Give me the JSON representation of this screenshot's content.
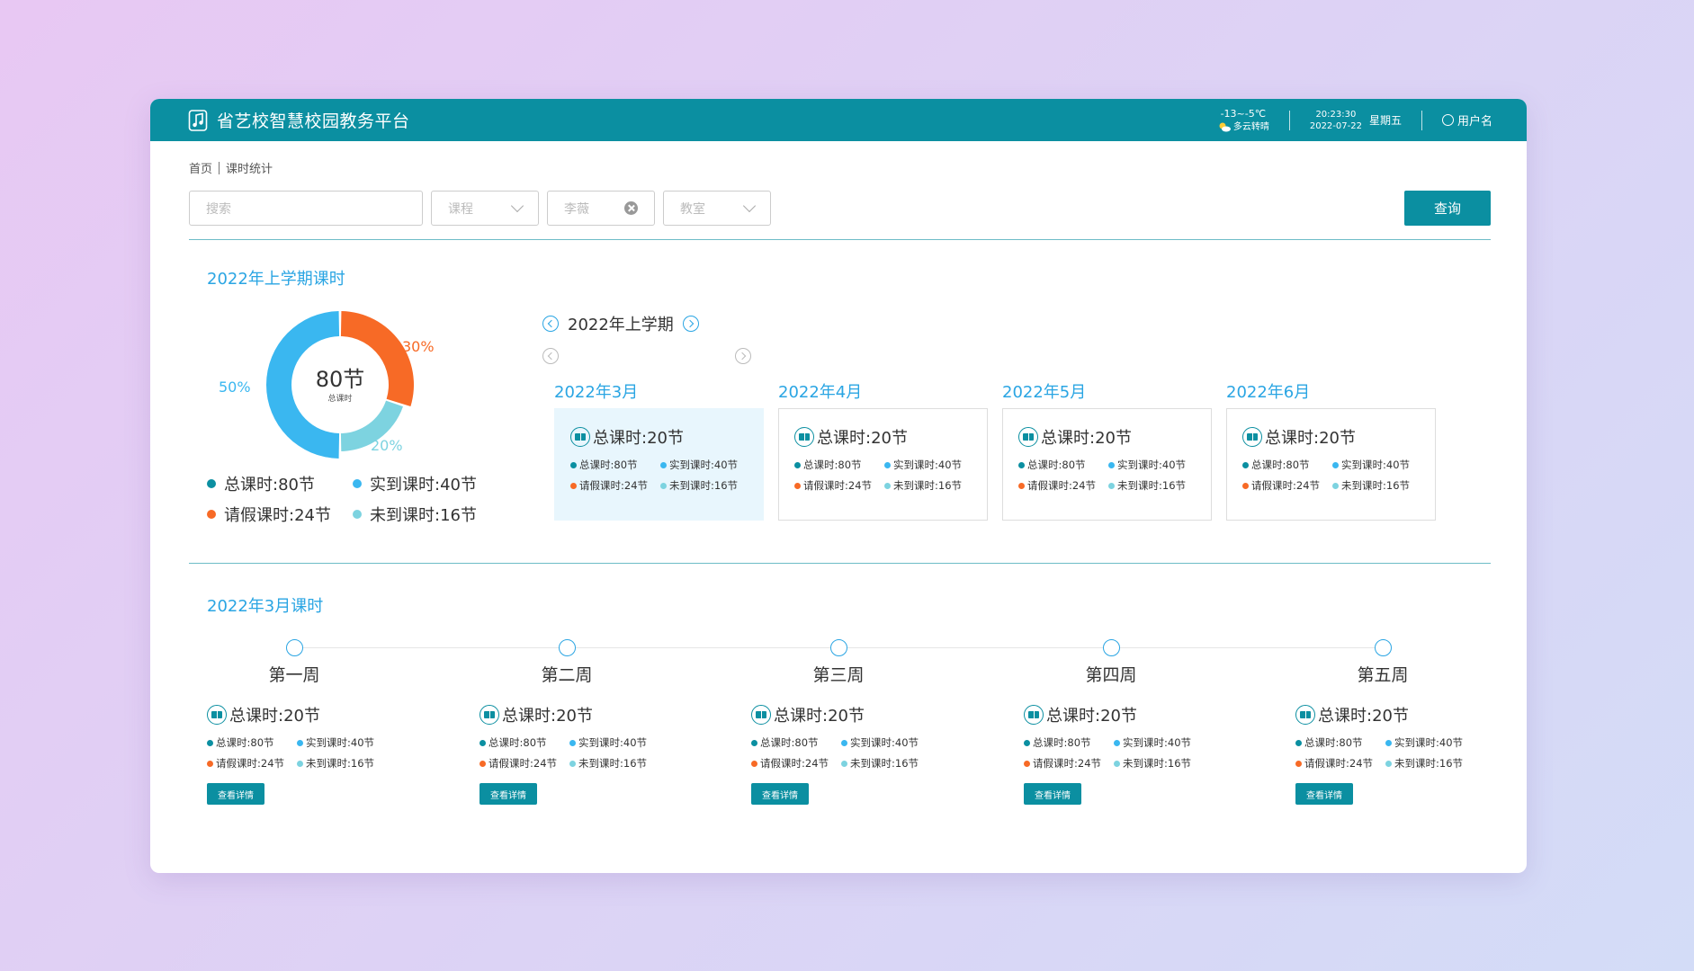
{
  "header": {
    "app_title": "省艺校智慧校园教务平台",
    "weather_temp": "-13~-5℃",
    "weather_cond": "多云转晴",
    "time": "20:23:30",
    "date": "2022-07-22",
    "weekday": "星期五",
    "user": "用户名"
  },
  "breadcrumb": {
    "home": "首页",
    "current": "课时统计"
  },
  "filters": {
    "search_placeholder": "搜索",
    "course": "课程",
    "teacher": "李薇",
    "classroom": "教室",
    "query_label": "查询"
  },
  "semester": {
    "section_title": "2022年上学期课时",
    "center_value": "80节",
    "center_label": "总课时",
    "pct_actual": "50%",
    "pct_leave": "30%",
    "pct_absent": "20%",
    "legend": {
      "total": "总课时:80节",
      "actual": "实到课时:40节",
      "leave": "请假课时:24节",
      "absent": "未到课时:16节"
    },
    "nav_label": "2022年上学期"
  },
  "colors": {
    "total": "#0b8fa1",
    "actual": "#3ab7f0",
    "leave": "#f76a26",
    "absent": "#7dd3e0"
  },
  "chart_data": {
    "type": "pie",
    "categories": [
      "实到课时",
      "请假课时",
      "未到课时"
    ],
    "values": [
      50,
      30,
      20
    ]
  },
  "months": [
    {
      "title": "2022年3月",
      "total": "总课时:20节",
      "s_total": "总课时:80节",
      "s_actual": "实到课时:40节",
      "s_leave": "请假课时:24节",
      "s_absent": "未到课时:16节"
    },
    {
      "title": "2022年4月",
      "total": "总课时:20节",
      "s_total": "总课时:80节",
      "s_actual": "实到课时:40节",
      "s_leave": "请假课时:24节",
      "s_absent": "未到课时:16节"
    },
    {
      "title": "2022年5月",
      "total": "总课时:20节",
      "s_total": "总课时:80节",
      "s_actual": "实到课时:40节",
      "s_leave": "请假课时:24节",
      "s_absent": "未到课时:16节"
    },
    {
      "title": "2022年6月",
      "total": "总课时:20节",
      "s_total": "总课时:80节",
      "s_actual": "实到课时:40节",
      "s_leave": "请假课时:24节",
      "s_absent": "未到课时:16节"
    }
  ],
  "month_section_title": "2022年3月课时",
  "weeks": [
    {
      "label": "第一周",
      "total": "总课时:20节",
      "s_total": "总课时:80节",
      "s_actual": "实到课时:40节",
      "s_leave": "请假课时:24节",
      "s_absent": "未到课时:16节",
      "btn": "查看详情"
    },
    {
      "label": "第二周",
      "total": "总课时:20节",
      "s_total": "总课时:80节",
      "s_actual": "实到课时:40节",
      "s_leave": "请假课时:24节",
      "s_absent": "未到课时:16节",
      "btn": "查看详情"
    },
    {
      "label": "第三周",
      "total": "总课时:20节",
      "s_total": "总课时:80节",
      "s_actual": "实到课时:40节",
      "s_leave": "请假课时:24节",
      "s_absent": "未到课时:16节",
      "btn": "查看详情"
    },
    {
      "label": "第四周",
      "total": "总课时:20节",
      "s_total": "总课时:80节",
      "s_actual": "实到课时:40节",
      "s_leave": "请假课时:24节",
      "s_absent": "未到课时:16节",
      "btn": "查看详情"
    },
    {
      "label": "第五周",
      "total": "总课时:20节",
      "s_total": "总课时:80节",
      "s_actual": "实到课时:40节",
      "s_leave": "请假课时:24节",
      "s_absent": "未到课时:16节",
      "btn": "查看详情"
    }
  ]
}
